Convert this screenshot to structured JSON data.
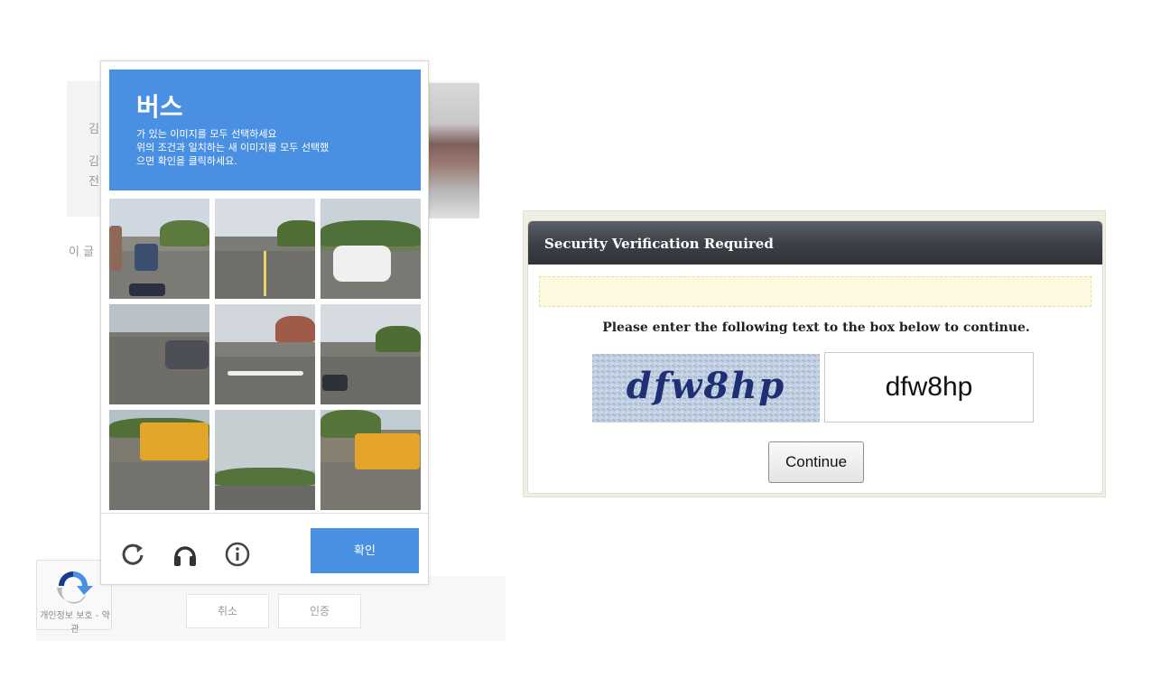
{
  "background_page": {
    "lines": [
      "김",
      "김",
      "전"
    ],
    "side_text": "이 글",
    "recaptcha_badge_text": "개인정보 보호 - 약관",
    "buttons": {
      "cancel_label": "취소",
      "confirm_label": "인증"
    }
  },
  "recaptcha": {
    "title": "버스",
    "instructions_line1": "가 있는 이미지를 모두 선택하세요",
    "instructions_line2": "위의 조건과 일치하는 새 이미지를 모두 선택했",
    "instructions_line3": "으면 확인을 클릭하세요.",
    "verify_label": "확인",
    "icons": [
      "reload-icon",
      "headphones-icon",
      "info-icon"
    ],
    "accent_color": "#4a90e2",
    "tiles": [
      {
        "scene": "street-with-bus"
      },
      {
        "scene": "empty-road"
      },
      {
        "scene": "white-car"
      },
      {
        "scene": "highway-car"
      },
      {
        "scene": "intersection"
      },
      {
        "scene": "traffic-light-road"
      },
      {
        "scene": "school-bus"
      },
      {
        "scene": "sky-trees"
      },
      {
        "scene": "school-bus-parked"
      }
    ]
  },
  "security": {
    "title": "Security Verification Required",
    "message": "Please enter the following text to the box below to continue.",
    "captcha_image_text": "dfw8hp",
    "input_value": "dfw8hp",
    "continue_label": "Continue"
  }
}
